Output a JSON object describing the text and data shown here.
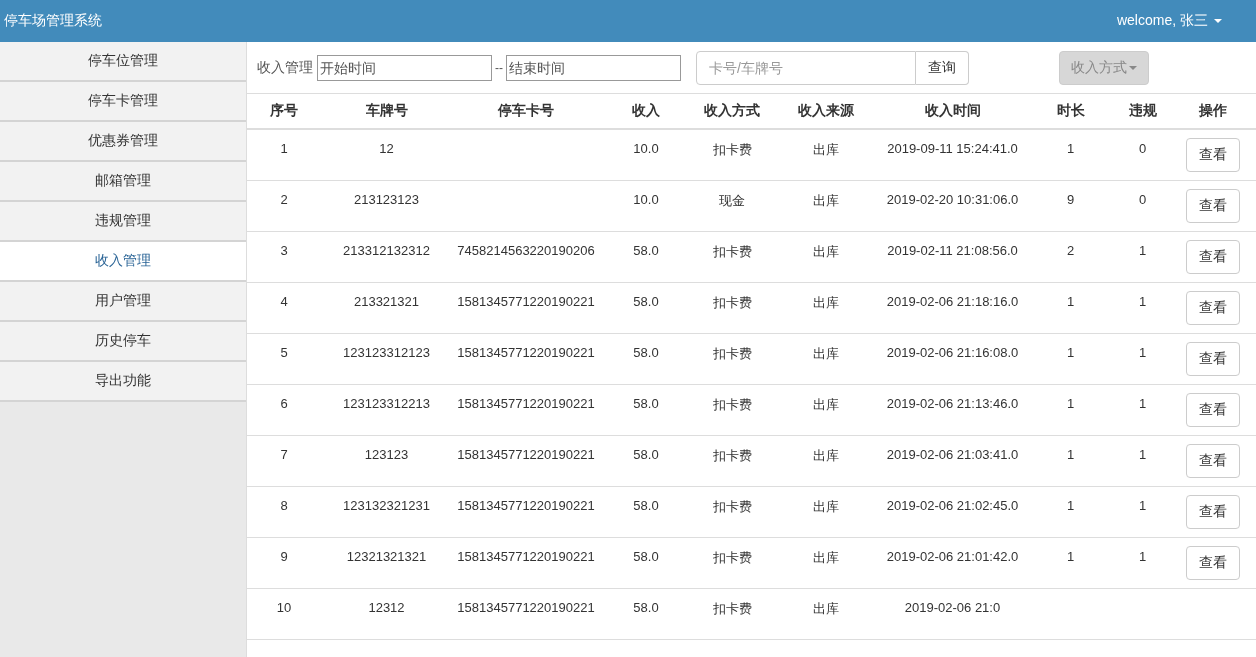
{
  "header": {
    "title": "停车场管理系统",
    "user_menu": "welcome, 张三"
  },
  "sidebar": {
    "items": [
      {
        "label": "停车位管理",
        "selected": false
      },
      {
        "label": "停车卡管理",
        "selected": false
      },
      {
        "label": "优惠券管理",
        "selected": false
      },
      {
        "label": "邮箱管理",
        "selected": false
      },
      {
        "label": "违规管理",
        "selected": false
      },
      {
        "label": "收入管理",
        "selected": true
      },
      {
        "label": "用户管理",
        "selected": false
      },
      {
        "label": "历史停车",
        "selected": false
      },
      {
        "label": "导出功能",
        "selected": false
      }
    ]
  },
  "filter": {
    "label": "收入管理",
    "start_placeholder": "开始时间",
    "separator": "--",
    "end_placeholder": "结束时间",
    "search_placeholder": "卡号/车牌号",
    "search_button": "查询",
    "method_dropdown": {
      "label": "收入方式",
      "disabled": true
    }
  },
  "table": {
    "columns": [
      "序号",
      "车牌号",
      "停车卡号",
      "收入",
      "收入方式",
      "收入来源",
      "收入时间",
      "时长",
      "违规",
      "操作"
    ],
    "rows": [
      {
        "cells": [
          "1",
          "12",
          "",
          "10.0",
          "扣卡费",
          "出库",
          "2019-09-11 15:24:41.0",
          "1",
          "0"
        ],
        "action": "查看"
      },
      {
        "cells": [
          "2",
          "213123123",
          "",
          "10.0",
          "现金",
          "出库",
          "2019-02-20 10:31:06.0",
          "9",
          "0"
        ],
        "action": "查看"
      },
      {
        "cells": [
          "3",
          "213312132312",
          "7458214563220190206",
          "58.0",
          "扣卡费",
          "出库",
          "2019-02-11 21:08:56.0",
          "2",
          "1"
        ],
        "action": "查看"
      },
      {
        "cells": [
          "4",
          "213321321",
          "1581345771220190221",
          "58.0",
          "扣卡费",
          "出库",
          "2019-02-06 21:18:16.0",
          "1",
          "1"
        ],
        "action": "查看"
      },
      {
        "cells": [
          "5",
          "123123312123",
          "1581345771220190221",
          "58.0",
          "扣卡费",
          "出库",
          "2019-02-06 21:16:08.0",
          "1",
          "1"
        ],
        "action": "查看"
      },
      {
        "cells": [
          "6",
          "123123312213",
          "1581345771220190221",
          "58.0",
          "扣卡费",
          "出库",
          "2019-02-06 21:13:46.0",
          "1",
          "1"
        ],
        "action": "查看"
      },
      {
        "cells": [
          "7",
          "123123",
          "1581345771220190221",
          "58.0",
          "扣卡费",
          "出库",
          "2019-02-06 21:03:41.0",
          "1",
          "1"
        ],
        "action": "查看"
      },
      {
        "cells": [
          "8",
          "123132321231",
          "1581345771220190221",
          "58.0",
          "扣卡费",
          "出库",
          "2019-02-06 21:02:45.0",
          "1",
          "1"
        ],
        "action": "查看"
      },
      {
        "cells": [
          "9",
          "12321321321",
          "1581345771220190221",
          "58.0",
          "扣卡费",
          "出库",
          "2019-02-06 21:01:42.0",
          "1",
          "1"
        ],
        "action": "查看"
      },
      {
        "cells": [
          "10",
          "12312",
          "1581345771220190221",
          "58.0",
          "扣卡费",
          "出库",
          "2019-02-06 21:0"
        ]
      }
    ]
  }
}
